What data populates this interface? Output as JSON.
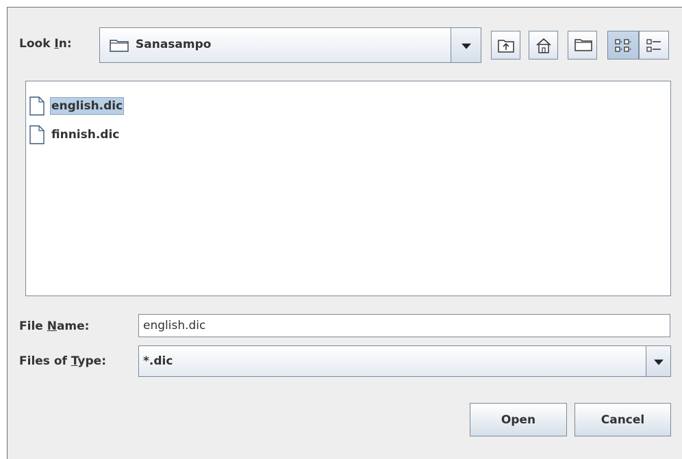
{
  "look_in": {
    "label_pre": "Look ",
    "label_mnemonic": "I",
    "label_post": "n:",
    "value": "Sanasampo"
  },
  "toolbar": {
    "icons": [
      "up-folder-icon",
      "home-icon",
      "new-folder-icon",
      "list-view-icon",
      "details-view-icon"
    ]
  },
  "files": [
    {
      "name": "english.dic",
      "selected": true
    },
    {
      "name": "finnish.dic",
      "selected": false
    }
  ],
  "file_name": {
    "label_pre": "File ",
    "label_mnemonic": "N",
    "label_post": "ame:",
    "value": "english.dic"
  },
  "file_type": {
    "label_pre": "Files of ",
    "label_mnemonic": "T",
    "label_post": "ype:",
    "value": "*.dic"
  },
  "buttons": {
    "open": "Open",
    "cancel": "Cancel"
  }
}
